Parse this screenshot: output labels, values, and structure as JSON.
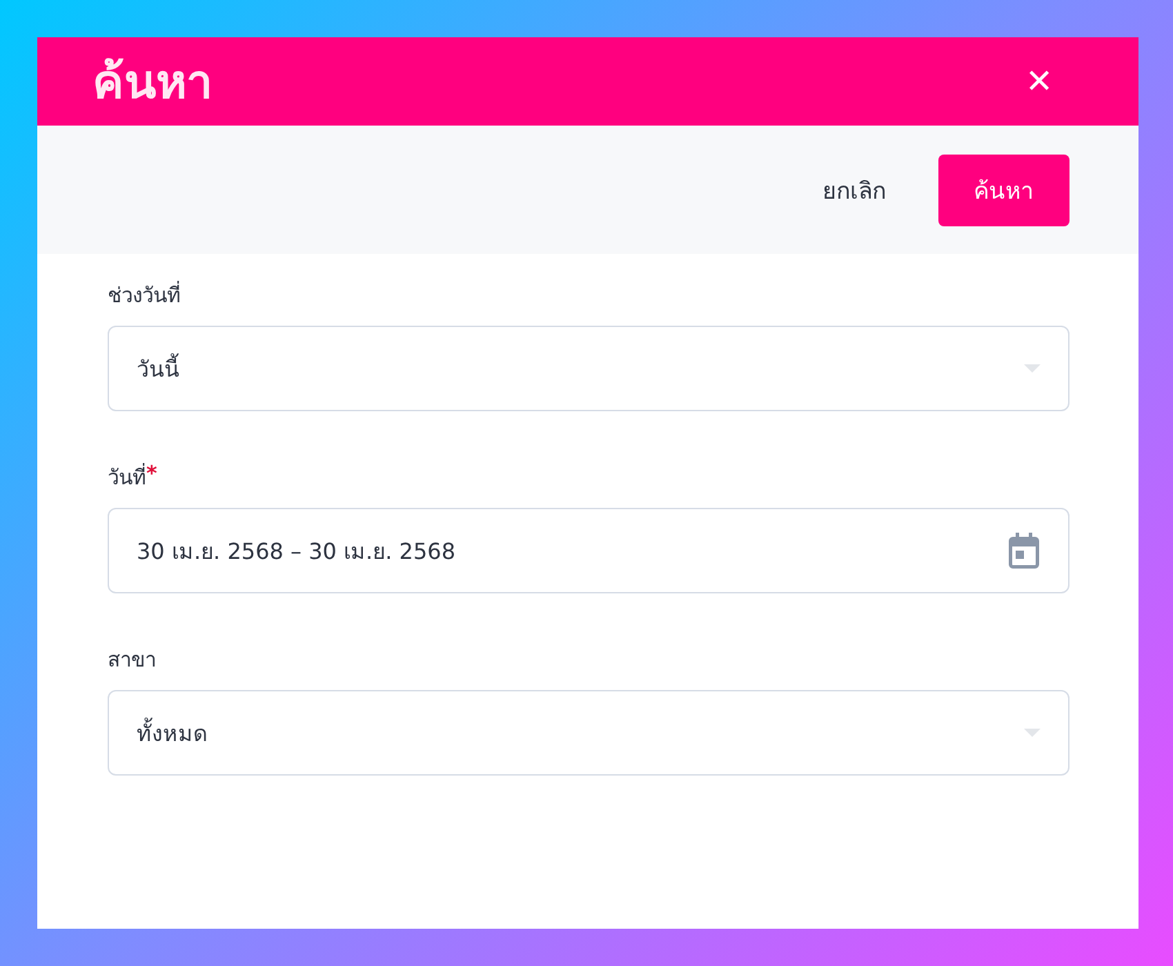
{
  "dialog": {
    "title": "ค้นหา",
    "close_icon": "✕"
  },
  "toolbar": {
    "cancel": "ยกเลิก",
    "submit": "ค้นหา"
  },
  "fields": [
    {
      "kind": "select",
      "label": "ช่วงวันที่",
      "value": "วันนี้"
    },
    {
      "kind": "date",
      "label": "วันที่",
      "required_mark": "*",
      "value": "30 เม.ย. 2568 – 30 เม.ย. 2568"
    },
    {
      "kind": "select",
      "label": "สาขา",
      "value": "ทั้งหมด"
    }
  ]
}
